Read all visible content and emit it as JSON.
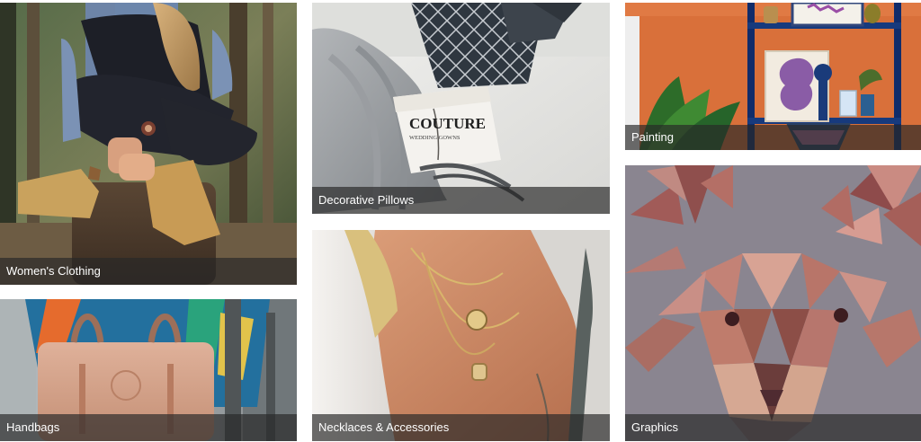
{
  "tiles": [
    {
      "label": "Women's Clothing"
    },
    {
      "label": "Decorative Pillows"
    },
    {
      "label": "Painting"
    },
    {
      "label": "Handbags"
    },
    {
      "label": "Necklaces & Accessories"
    },
    {
      "label": "Graphics"
    }
  ],
  "pillows_book": {
    "title": "COUTURE",
    "subtitle": "WEDDING GOWNS"
  },
  "colors": {
    "caption_overlay": "#282828",
    "caption_text": "#ffffff",
    "page_background": "#ffffff",
    "painting_wall": "#d9703a",
    "graphics_background": "#8f8a95"
  },
  "icons": []
}
